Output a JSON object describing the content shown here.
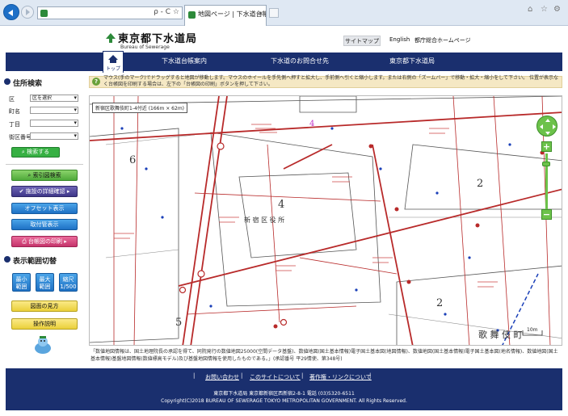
{
  "browser": {
    "address_tools": "ρ - C ☆",
    "tab_title": "地図ページ | 下水道台帳...",
    "tab_close": "×"
  },
  "header": {
    "logo_title": "東京都下水道局",
    "logo_sub": "Bureau of Sewerage",
    "sitemap": "サイトマップ",
    "english": "English",
    "portal": "都庁総合ホームページ"
  },
  "gnav": {
    "home": "トップ",
    "items": [
      "下水道台帳案内",
      "下水道のお問合せ先",
      "東京都下水道局"
    ]
  },
  "sidebar": {
    "address_search": "住所検索",
    "ward_label": "区",
    "ward_value": "区を選択",
    "town_label": "町名",
    "chome_label": "丁目",
    "block_label": "街区番号",
    "search_button": "検索する",
    "index_search": "索引図検索",
    "facility_detail": "施設の詳細確認",
    "offset_display": "オフセット表示",
    "outfall_display": "取付管表示",
    "print": "台帳図の印刷",
    "display_range": "表示範囲切替",
    "scale_min": [
      "最小",
      "範囲"
    ],
    "scale_max": [
      "最大",
      "範囲"
    ],
    "scale_1500": [
      "縮尺",
      "1/500"
    ],
    "how_to_read": "図面の見方",
    "manual": "操作説明"
  },
  "notice": {
    "text": "マウス(手のマーク)でドラッグすると地図が移動します。マウスのホイールを手先側へ押すと拡大し、手前側へ引くと縮小します。または右側の「ズームバー」で移動・拡大・縮小をして下さい。 位置が表示なく台帳図を印刷する場合は、左下の「台帳図の印刷」ボタンを押して下さい。"
  },
  "map": {
    "caption": "新宿区歌舞伎町1-4付近 (166m × 62m)",
    "block_numbers": [
      "6",
      "4",
      "2",
      "2",
      "5",
      "4"
    ],
    "office_label": "新 宿 区 役 所",
    "street_label": "歌  舞  伎  町",
    "scale_label": "10m"
  },
  "zoom": {
    "plus": "+",
    "minus": "−"
  },
  "credits": "「数値地図情報は、国土地理院長の承認を得て、同院発行の数値地図25000(空間データ基盤)、数値地図(国土基本情報)電子国土基本図(地図情報)、数値地図(国土基本情報)電子国土基本図(地名情報)、数値地図(国土基本情報)基盤地図情報(数値標高モデル)及び基盤地図情報を使用したものである。」(承認番号 平29情使、第348号)",
  "footer": {
    "links": [
      "お問い合わせ",
      "このサイトについて",
      "著作権・リンクについて"
    ],
    "address": "東京都下水道局  東京都新宿区西新宿2-8-1 電話 (03)5320-6511",
    "copyright": "Copyright(C)2018 BUREAU OF SEWERAGE TOKYO METROPOLITAN GOVERNMENT. All Rights Reserved."
  }
}
